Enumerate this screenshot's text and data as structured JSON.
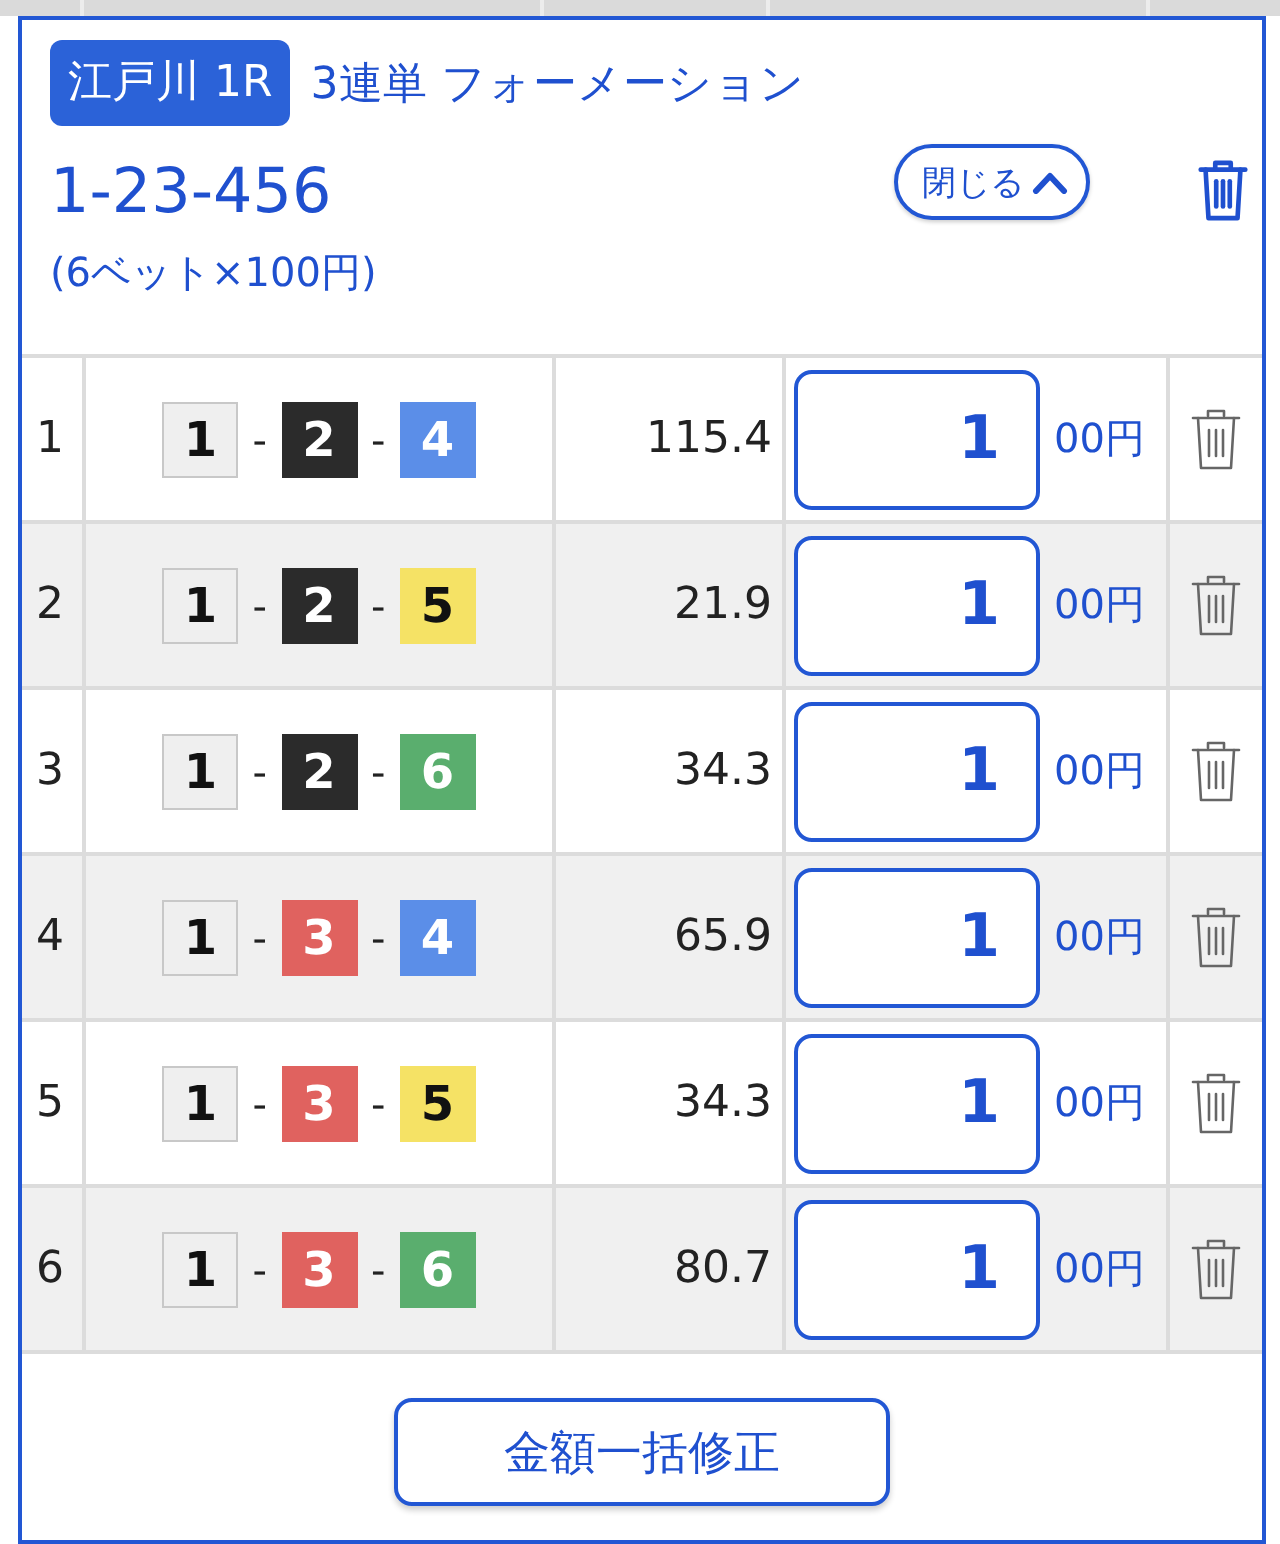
{
  "race": {
    "venue": "江戸川 1R",
    "bet_type": "3連単 フォーメーション",
    "combination": "1-23-456",
    "summary": "(6ベット×100円)",
    "close_button": "閉じる"
  },
  "bets": [
    {
      "no": "1",
      "boats": [
        {
          "number": "1",
          "color": "#efefef"
        },
        {
          "number": "2",
          "color": "#2b2b2b"
        },
        {
          "number": "4",
          "color": "#5b8ee8"
        }
      ],
      "separators": [
        "-",
        "-"
      ],
      "odds": "115.4",
      "amount": "1",
      "unit": "00円"
    },
    {
      "no": "2",
      "boats": [
        {
          "number": "1",
          "color": "#efefef"
        },
        {
          "number": "2",
          "color": "#2b2b2b"
        },
        {
          "number": "5",
          "color": "#f5e265"
        }
      ],
      "separators": [
        "-",
        "-"
      ],
      "odds": "21.9",
      "amount": "1",
      "unit": "00円"
    },
    {
      "no": "3",
      "boats": [
        {
          "number": "1",
          "color": "#efefef"
        },
        {
          "number": "2",
          "color": "#2b2b2b"
        },
        {
          "number": "6",
          "color": "#5aae6e"
        }
      ],
      "separators": [
        "-",
        "-"
      ],
      "odds": "34.3",
      "amount": "1",
      "unit": "00円"
    },
    {
      "no": "4",
      "boats": [
        {
          "number": "1",
          "color": "#efefef"
        },
        {
          "number": "3",
          "color": "#e0625f"
        },
        {
          "number": "4",
          "color": "#5b8ee8"
        }
      ],
      "separators": [
        "-",
        "-"
      ],
      "odds": "65.9",
      "amount": "1",
      "unit": "00円"
    },
    {
      "no": "5",
      "boats": [
        {
          "number": "1",
          "color": "#efefef"
        },
        {
          "number": "3",
          "color": "#e0625f"
        },
        {
          "number": "5",
          "color": "#f5e265"
        }
      ],
      "separators": [
        "-",
        "-"
      ],
      "odds": "34.3",
      "amount": "1",
      "unit": "00円"
    },
    {
      "no": "6",
      "boats": [
        {
          "number": "1",
          "color": "#efefef"
        },
        {
          "number": "3",
          "color": "#e0625f"
        },
        {
          "number": "6",
          "color": "#5aae6e"
        }
      ],
      "separators": [
        "-",
        "-"
      ],
      "odds": "80.7",
      "amount": "1",
      "unit": "00円"
    }
  ],
  "bulk_edit_button": "金額一括修正"
}
